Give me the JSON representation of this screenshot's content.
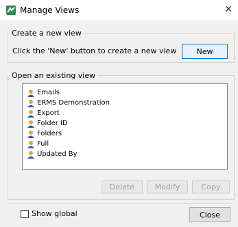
{
  "window": {
    "title": "Manage Views"
  },
  "create_group": {
    "legend": "Create a new view",
    "hint": "Click the 'New' button to create a new view",
    "new_button": "New"
  },
  "open_group": {
    "legend": "Open an existing view",
    "items": [
      "Emails",
      "ERMS Demonstration",
      "Export",
      "Folder ID",
      "Folders",
      "Full",
      "Updated By"
    ],
    "item_icon": "user-icon",
    "delete_button": "Delete",
    "modify_button": "Modify",
    "copy_button": "Copy"
  },
  "footer": {
    "show_global_label": "Show global",
    "show_global_checked": false,
    "close_button": "Close"
  },
  "colors": {
    "app_icon": "#2e8b57",
    "accent_border": "#0078d7"
  }
}
